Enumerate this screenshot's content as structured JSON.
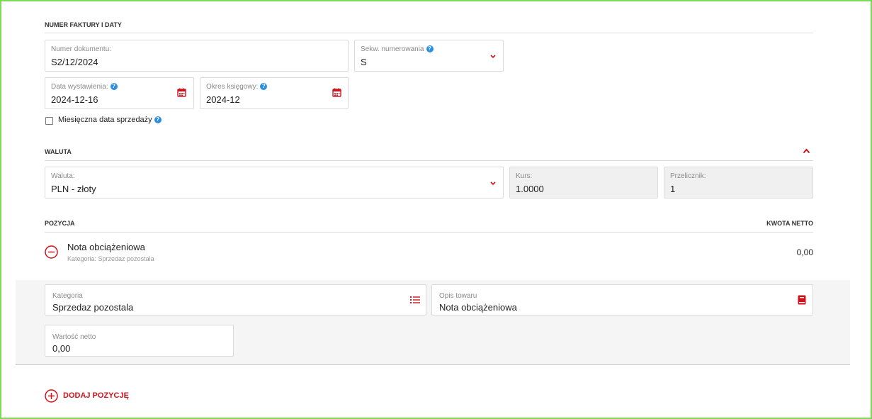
{
  "sections": {
    "invoice": "NUMER FAKTURY I DATY",
    "currency": "WALUTA",
    "position": "POZYCJA",
    "net_amount": "KWOTA NETTO"
  },
  "invoice": {
    "doc_number": {
      "label": "Numer dokumentu:",
      "value": "S2/12/2024"
    },
    "sequence": {
      "label": "Sekw. numerowania",
      "value": "S"
    },
    "issue_date": {
      "label": "Data wystawienia:",
      "value": "2024-12-16"
    },
    "accounting_period": {
      "label": "Okres księgowy:",
      "value": "2024-12"
    },
    "monthly_sale_date": {
      "label": "Miesięczna data sprzedaży",
      "checked": false
    }
  },
  "currency": {
    "currency": {
      "label": "Waluta:",
      "value": "PLN - złoty"
    },
    "rate": {
      "label": "Kurs:",
      "value": "1.0000"
    },
    "converter": {
      "label": "Przelicznik:",
      "value": "1"
    }
  },
  "item": {
    "name": "Nota obciążeniowa",
    "category_line": "Kategoria: Sprzedaz pozostala",
    "amount": "0,00",
    "category": {
      "label": "Kategoria",
      "value": "Sprzedaz pozostala"
    },
    "description": {
      "label": "Opis towaru",
      "value": "Nota obciążeniowa"
    },
    "net_value": {
      "label": "Wartość netto",
      "value": "0,00"
    }
  },
  "actions": {
    "add_position": "DODAJ POZYCJĘ"
  },
  "colors": {
    "accent": "#d0121b",
    "help": "#2a8fe0",
    "frame": "#7ed957"
  },
  "icons": [
    "chevron-down-icon",
    "calendar-icon",
    "help-icon",
    "chevron-up-icon",
    "remove-circle-icon",
    "list-icon",
    "book-icon",
    "add-circle-icon"
  ]
}
